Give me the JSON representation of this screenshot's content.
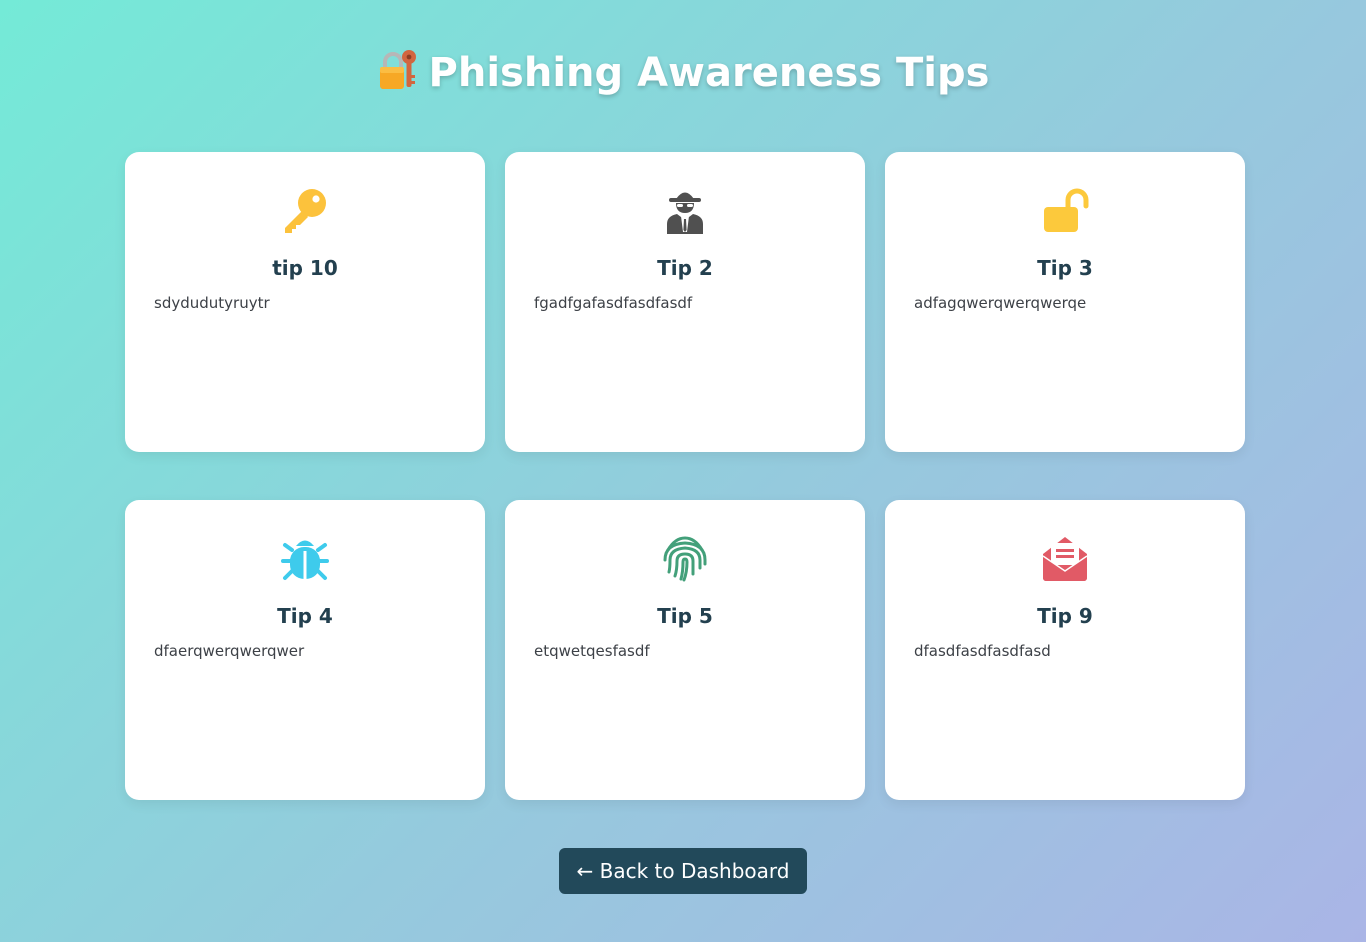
{
  "header": {
    "title": "Phishing Awareness Tips",
    "icon": "locked-with-key-icon"
  },
  "tips": [
    {
      "title": "tip 10",
      "text": "sdydudutyruytr",
      "icon": "key-icon",
      "color": "#fcc23c"
    },
    {
      "title": "Tip 2",
      "text": "fgadfgafasdfasdfasdf",
      "icon": "hacker-spy-icon",
      "color": "#505050"
    },
    {
      "title": "Tip 3",
      "text": "adfagqwerqwerqwerqe",
      "icon": "unlocked-padlock-icon",
      "color": "#fcc93c"
    },
    {
      "title": "Tip 4",
      "text": "dfaerqwerqwerqwer",
      "icon": "bug-icon",
      "color": "#3ecbec"
    },
    {
      "title": "Tip 5",
      "text": "etqwetqesfasdf",
      "icon": "fingerprint-icon",
      "color": "#43a07a"
    },
    {
      "title": "Tip 9",
      "text": "dfasdfasdfasdfasd",
      "icon": "envelope-open-text-icon",
      "color": "#e15a66"
    }
  ],
  "footer": {
    "back_label": "← Back to Dashboard"
  }
}
